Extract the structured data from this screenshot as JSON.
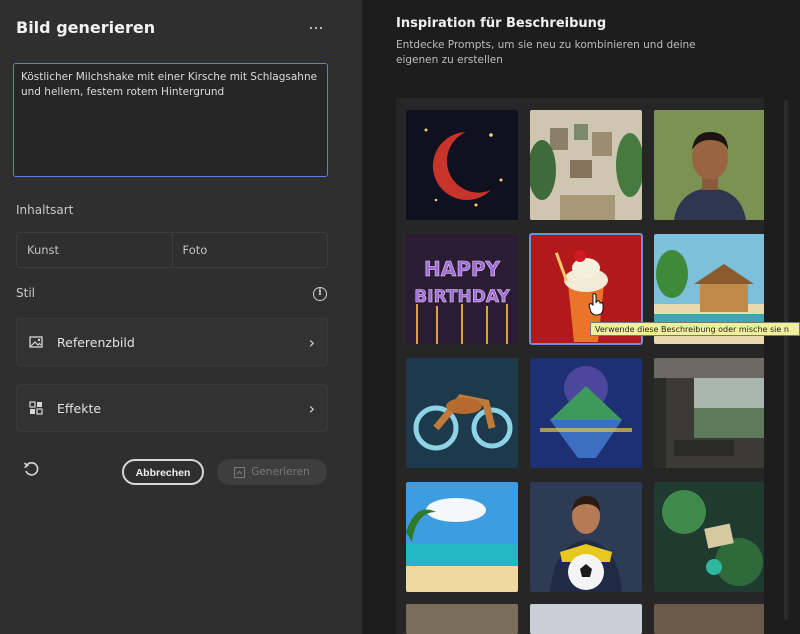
{
  "left_panel": {
    "title": "Bild generieren",
    "more_label": "...",
    "prompt_text": "Köstlicher Milchshake mit einer Kirsche mit Schlagsahne und hellem, festem rotem Hintergrund",
    "content_type_label": "Inhaltsart",
    "content_types": [
      "Kunst",
      "Foto"
    ],
    "style_label": "Stil",
    "reference_image_label": "Referenzbild",
    "effects_label": "Effekte",
    "cancel_label": "Abbrechen",
    "generate_label": "Generieren"
  },
  "right_panel": {
    "title": "Inspiration für Beschreibung",
    "description": "Entdecke Prompts, um sie neu zu kombinieren und deine eigenen zu erstellen",
    "tiles": [
      {
        "name": "moon",
        "scene": "roter Halbmond"
      },
      {
        "name": "room",
        "scene": "Zimmer mit Pflanzen"
      },
      {
        "name": "portrait",
        "scene": "Porträt Mann"
      },
      {
        "name": "birthday",
        "scene": "HAPPY BIRTHDAY"
      },
      {
        "name": "milkshake",
        "scene": "Milchshake"
      },
      {
        "name": "house",
        "scene": "Haus am Strand"
      },
      {
        "name": "motorcycle",
        "scene": "Motorrad"
      },
      {
        "name": "island",
        "scene": "schwebende Insel"
      },
      {
        "name": "interior",
        "scene": "Innenraum"
      },
      {
        "name": "beach",
        "scene": "Strand"
      },
      {
        "name": "soccer",
        "scene": "Fußballspielerin"
      },
      {
        "name": "diorama",
        "scene": "Miniatur"
      }
    ],
    "birthday_text_1": "HAPPY",
    "birthday_text_2": "BIRTHDAY",
    "tooltip": "Verwende diese Beschreibung oder mische sie n"
  },
  "colors": {
    "accent_blue": "#5b7fd6",
    "tooltip_bg": "#f2ef9a"
  }
}
